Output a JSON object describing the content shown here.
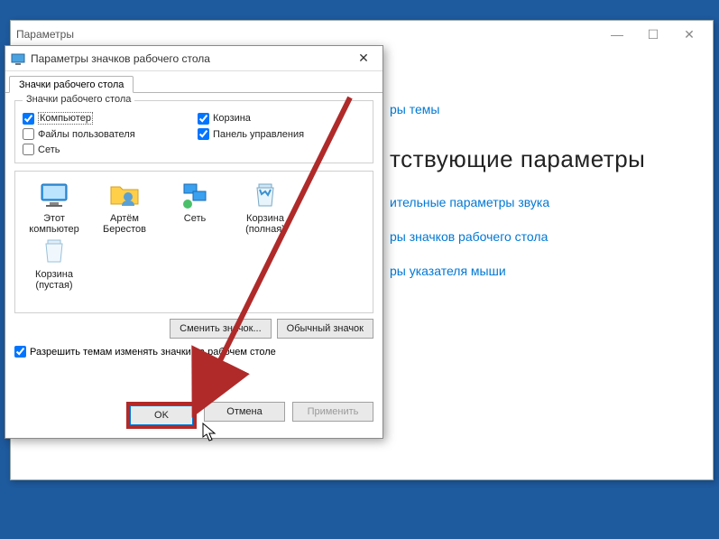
{
  "settings": {
    "title": "Параметры",
    "visible_section": "ры темы",
    "heading_partial": "тствующие параметры",
    "links": {
      "sound": "ительные параметры звука",
      "icons": "ры значков рабочего стола",
      "cursor": "ры указателя мыши"
    }
  },
  "dialog": {
    "title": "Параметры значков рабочего стола",
    "tab": "Значки рабочего стола",
    "group_legend": "Значки рабочего стола",
    "checks": {
      "computer": {
        "label": "Компьютер",
        "checked": true
      },
      "recycle": {
        "label": "Корзина",
        "checked": true
      },
      "userfiles": {
        "label": "Файлы пользователя",
        "checked": false
      },
      "ctrlpanel": {
        "label": "Панель управления",
        "checked": true
      },
      "network": {
        "label": "Сеть",
        "checked": false
      }
    },
    "icons": [
      {
        "key": "this-pc",
        "label": "Этот\nкомпьютер"
      },
      {
        "key": "user",
        "label": "Артём\nБерестов"
      },
      {
        "key": "network",
        "label": "Сеть"
      },
      {
        "key": "recycle-full",
        "label": "Корзина\n(полная)"
      },
      {
        "key": "recycle-empty",
        "label": "Корзина\n(пустая)"
      }
    ],
    "change_icon": "Сменить значок...",
    "default_icon": "Обычный значок",
    "allow_themes": {
      "label": "Разрешить темам изменять значки на рабочем столе",
      "checked": true
    },
    "ok": "OK",
    "cancel": "Отмена",
    "apply": "Применить"
  }
}
